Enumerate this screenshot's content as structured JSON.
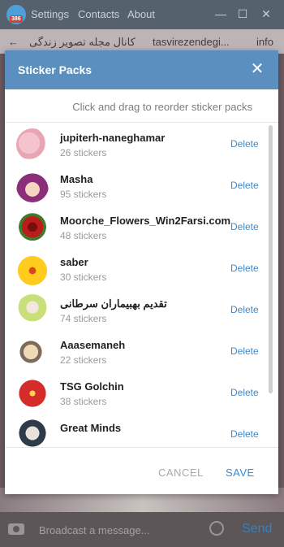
{
  "window": {
    "menu": [
      "Settings",
      "Contacts",
      "About"
    ],
    "badge": "386"
  },
  "chat": {
    "title_fa": "کانال مجله تصویر زندگی",
    "title_en": "tasvirezendegi...",
    "tail": "info"
  },
  "dialog": {
    "title": "Sticker Packs",
    "hint": "Click and drag to reorder sticker packs",
    "cancel_label": "CANCEL",
    "save_label": "SAVE",
    "packs": [
      {
        "name": "jupiterh-naneghamar",
        "count": "26 stickers",
        "delete": "Delete"
      },
      {
        "name": "Masha",
        "count": "95 stickers",
        "delete": "Delete"
      },
      {
        "name": "Moorche_Flowers_Win2Farsi.com",
        "count": "48 stickers",
        "delete": "Delete"
      },
      {
        "name": "saber",
        "count": "30 stickers",
        "delete": "Delete"
      },
      {
        "name": "تقدیم بهبیماران سرطانی",
        "count": "74 stickers",
        "delete": "Delete"
      },
      {
        "name": "Aaasemaneh",
        "count": "22 stickers",
        "delete": "Delete"
      },
      {
        "name": "TSG Golchin",
        "count": "38 stickers",
        "delete": "Delete"
      },
      {
        "name": "Great Minds",
        "count": "",
        "delete": "Delete"
      }
    ]
  },
  "composer": {
    "placeholder": "Broadcast a message...",
    "send_label": "Send"
  }
}
